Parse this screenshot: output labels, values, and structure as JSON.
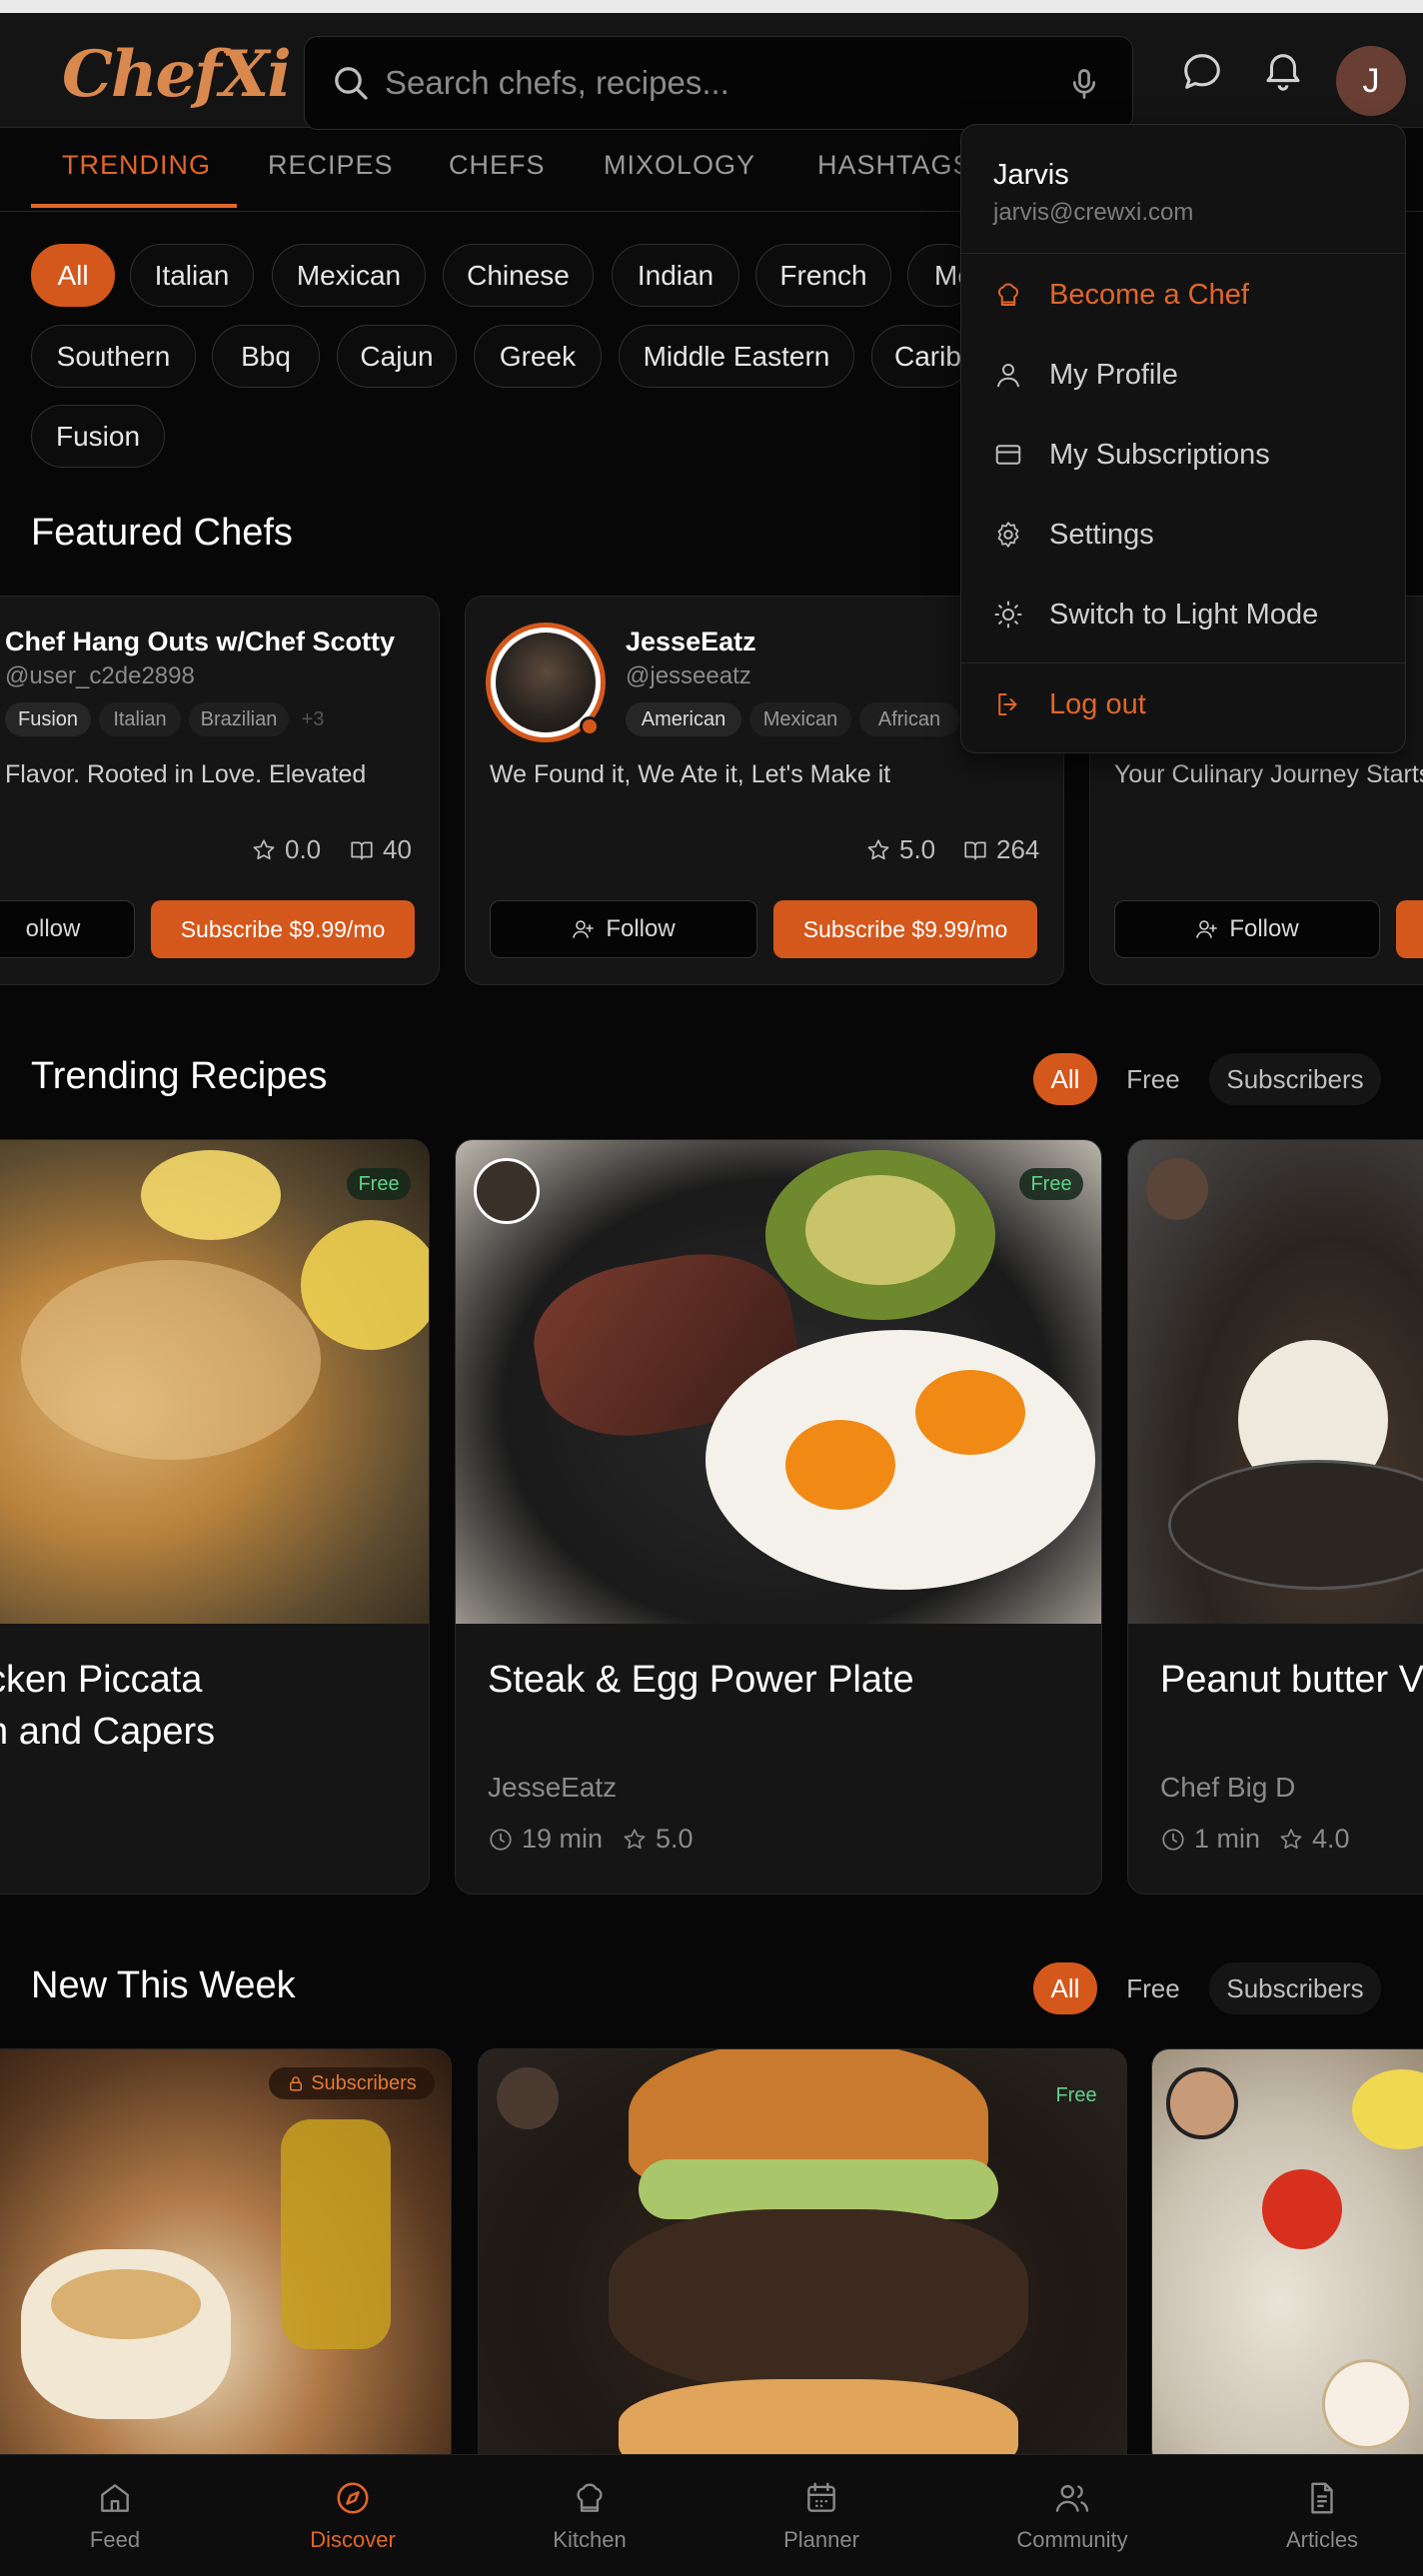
{
  "app": {
    "logo": "ChefXi"
  },
  "search": {
    "placeholder": "Search chefs, recipes..."
  },
  "user": {
    "initial": "J",
    "name": "Jarvis",
    "email": "jarvis@crewxi.com"
  },
  "tabs": [
    "TRENDING",
    "RECIPES",
    "CHEFS",
    "MIXOLOGY",
    "HASHTAGS"
  ],
  "cuisines": [
    "All",
    "Italian",
    "Mexican",
    "Chinese",
    "Indian",
    "French",
    "Me",
    "Southern",
    "Bbq",
    "Cajun",
    "Greek",
    "Middle Eastern",
    "Carib",
    "Fusion"
  ],
  "featured": {
    "title": "Featured Chefs",
    "chefs": [
      {
        "name": "Chef Hang Outs w/Chef Scotty",
        "handle": "@user_c2de2898",
        "tags": [
          "Fusion",
          "Italian",
          "Brazilian",
          "+3"
        ],
        "bio": "Flavor. Rooted in Love. Elevated",
        "rating": "0.0",
        "recipes": "40",
        "follow": "ollow",
        "subscribe": "Subscribe $9.99/mo"
      },
      {
        "name": "JesseEatz",
        "handle": "@jesseeatz",
        "tags": [
          "American",
          "Mexican",
          "African"
        ],
        "bio": "We Found it, We Ate it, Let's Make it",
        "rating": "5.0",
        "recipes": "264",
        "follow": "Follow",
        "subscribe": "Subscribe $9.99/mo"
      },
      {
        "name": "",
        "handle": "",
        "tags": [],
        "bio": "Your Culinary Journey Starts",
        "rating": "",
        "recipes": "",
        "follow": "Follow",
        "subscribe": ""
      }
    ]
  },
  "trending": {
    "title": "Trending Recipes",
    "filters": [
      "All",
      "Free",
      "Subscribers"
    ],
    "recipes": [
      {
        "title_line1": "cken Piccata",
        "title_line2": "n and Capers",
        "chef": "",
        "badge": "Free",
        "time": "",
        "rating": ""
      },
      {
        "title_line1": "Steak & Egg Power Plate",
        "title_line2": "",
        "chef": "JesseEatz",
        "badge": "Free",
        "time": "19 min",
        "rating": "5.0"
      },
      {
        "title_line1": "Peanut butter V",
        "title_line2": "",
        "chef": "Chef Big D",
        "badge": "",
        "time": "1 min",
        "rating": "4.0"
      }
    ]
  },
  "newweek": {
    "title": "New This Week",
    "filters": [
      "All",
      "Free",
      "Subscribers"
    ],
    "badges": [
      "Subscribers",
      "Free"
    ]
  },
  "menu": {
    "items": [
      "Become a Chef",
      "My Profile",
      "My Subscriptions",
      "Settings",
      "Switch to Light Mode",
      "Log out"
    ],
    "accent": "#e0662a"
  },
  "nav": [
    "Feed",
    "Discover",
    "Kitchen",
    "Planner",
    "Community",
    "Articles"
  ],
  "colors": {
    "accent": "#d4581c",
    "background": "#070707",
    "free": "#5fd38a"
  }
}
